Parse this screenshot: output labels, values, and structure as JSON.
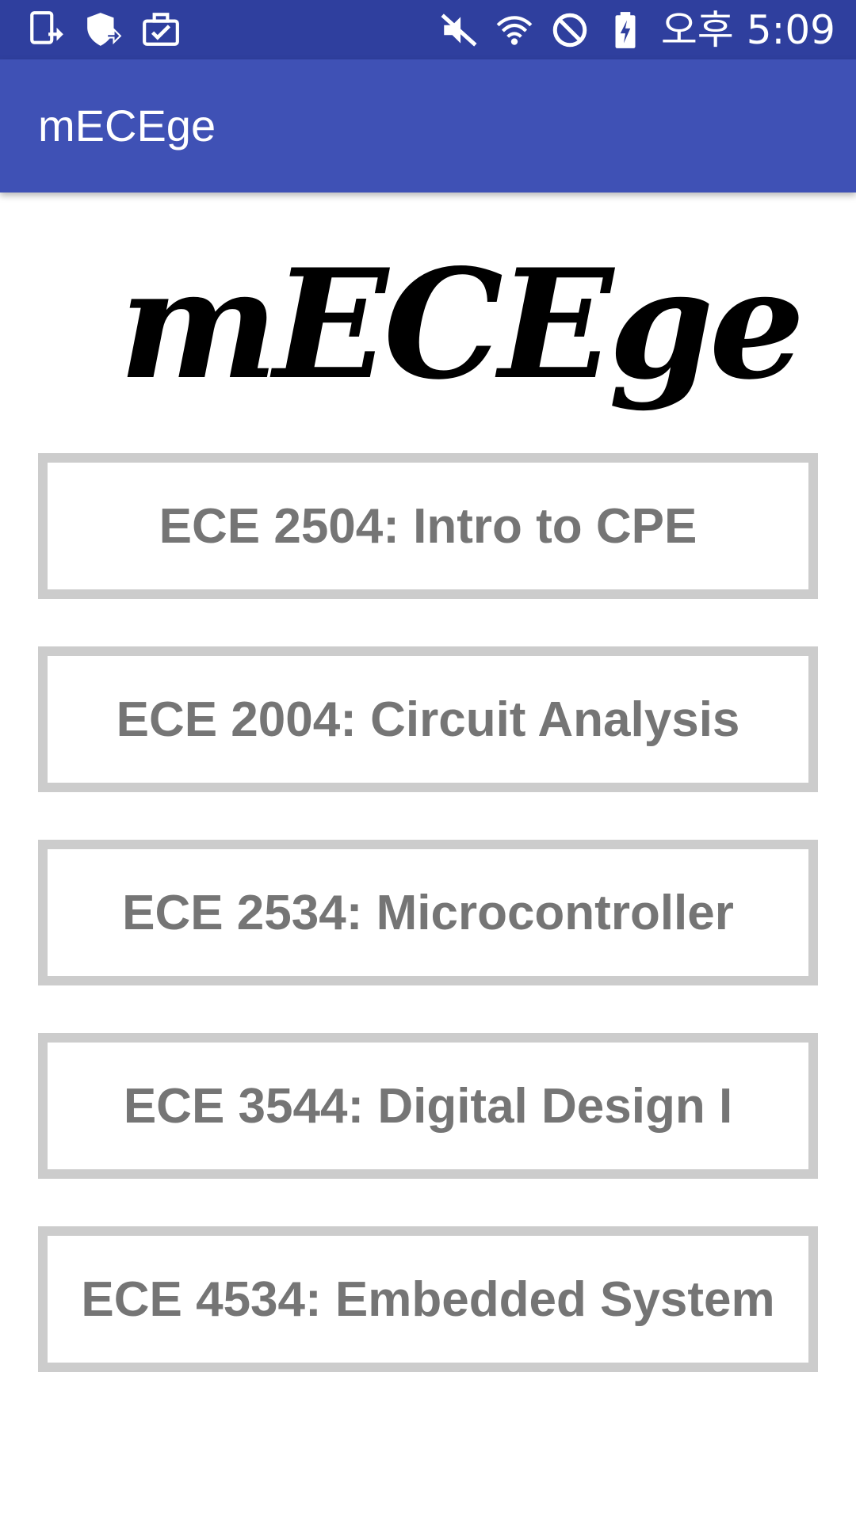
{
  "status_bar": {
    "left_icons": [
      "screen-update-icon",
      "shield-update-icon",
      "briefcase-check-icon"
    ],
    "right_icons": [
      "muted-icon",
      "wifi-icon",
      "do-not-disturb-icon",
      "battery-charging-icon"
    ],
    "time": "오후 5:09"
  },
  "app_bar": {
    "title": "mECEge"
  },
  "logo": {
    "text": "mECEge"
  },
  "courses": [
    {
      "label": "ECE 2504: Intro to CPE"
    },
    {
      "label": "ECE 2004: Circuit Analysis"
    },
    {
      "label": "ECE 2534: Microcontroller"
    },
    {
      "label": "ECE 3544: Digital Design I"
    },
    {
      "label": "ECE 4534: Embedded System"
    }
  ],
  "colors": {
    "status_bar": "#2f3f9e",
    "app_bar": "#3f51b5",
    "button_border": "#cccccc",
    "button_text": "#757575"
  }
}
